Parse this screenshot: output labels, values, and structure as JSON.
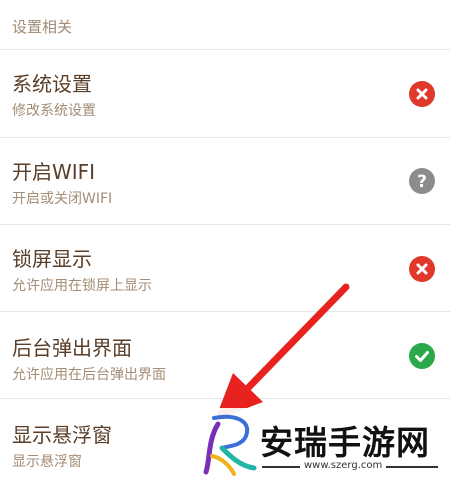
{
  "section": {
    "header": "设置相关"
  },
  "rows": [
    {
      "title": "系统设置",
      "subtitle": "修改系统设置",
      "status": "denied",
      "status_icon": "x-circle-icon",
      "status_color": "#e0392b"
    },
    {
      "title": "开启WIFI",
      "subtitle": "开启或关闭WIFI",
      "status": "unknown",
      "status_icon": "question-circle-icon",
      "status_color": "#8c8c8c"
    },
    {
      "title": "锁屏显示",
      "subtitle": "允许应用在锁屏上显示",
      "status": "denied",
      "status_icon": "x-circle-icon",
      "status_color": "#e0392b"
    },
    {
      "title": "后台弹出界面",
      "subtitle": "允许应用在后台弹出界面",
      "status": "allowed",
      "status_icon": "check-circle-icon",
      "status_color": "#2aa84a"
    },
    {
      "title": "显示悬浮窗",
      "subtitle": "显示悬浮窗"
    }
  ],
  "annotation": {
    "arrow_color": "#e8231f",
    "arrow_icon": "red-arrow-icon"
  },
  "watermark": {
    "text": "安瑞手游网",
    "url": "www.szerg.com"
  }
}
